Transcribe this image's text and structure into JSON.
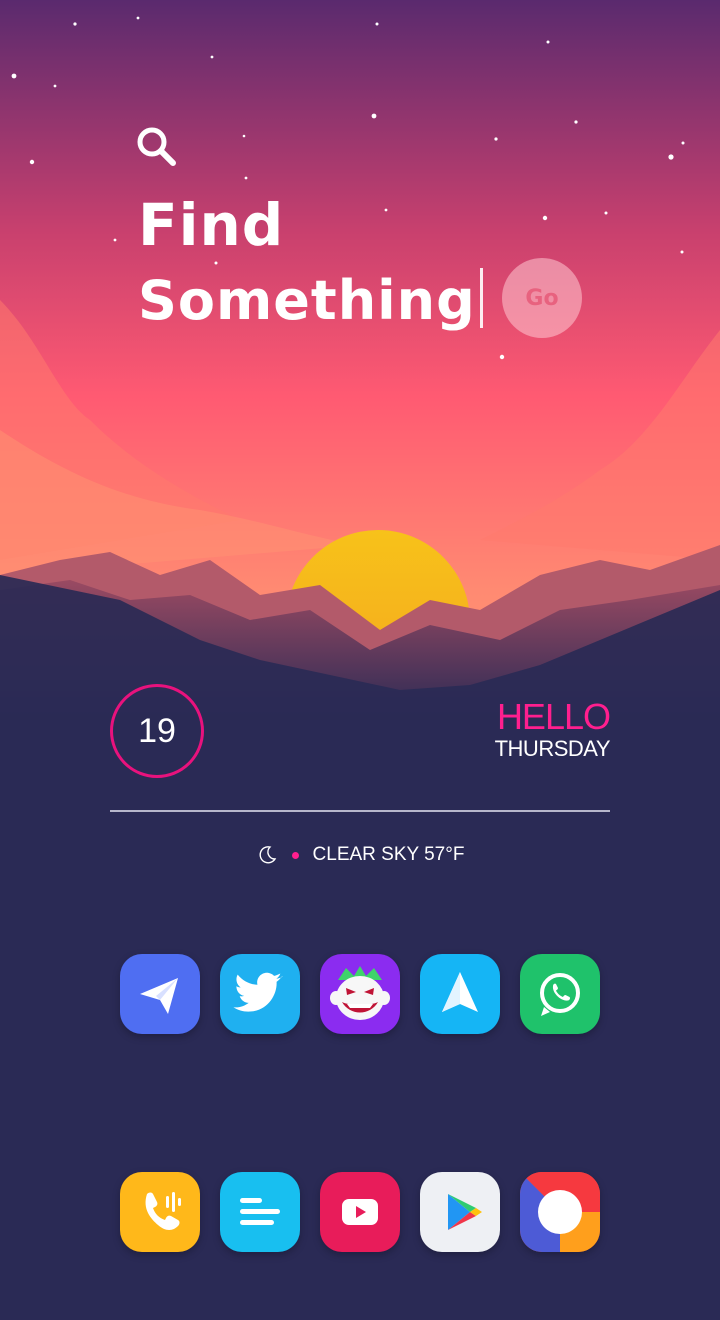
{
  "search": {
    "line1": "Find",
    "line2": "Something",
    "go_label": "Go"
  },
  "widget": {
    "date": "19",
    "greeting": "HELLO",
    "day": "THURSDAY",
    "weather": "CLEAR SKY 57°F"
  },
  "colors": {
    "accent": "#ff1f8e",
    "background": "#2a2a55",
    "sky_top": "#5a2a6e",
    "sky_bottom": "#ff7a6a",
    "sun": "#f7c21a"
  },
  "dock_rows": [
    {
      "apps": [
        {
          "name": "telegram",
          "icon": "paper-plane-icon",
          "color": "#4f6ef2"
        },
        {
          "name": "twitter",
          "icon": "bird-icon",
          "color": "#1fb0f0"
        },
        {
          "name": "joker-game",
          "icon": "joker-face-icon",
          "color": "#8b2cf0"
        },
        {
          "name": "spark-mail",
          "icon": "arrow-up-icon",
          "color": "#15b5f5"
        },
        {
          "name": "whatsapp",
          "icon": "whatsapp-icon",
          "color": "#1fc26b"
        }
      ]
    },
    {
      "apps": [
        {
          "name": "phone",
          "icon": "phone-icon",
          "color": "#ffb81a"
        },
        {
          "name": "messages",
          "icon": "lines-icon",
          "color": "#18bff0"
        },
        {
          "name": "youtube",
          "icon": "play-box-icon",
          "color": "#e81c5a"
        },
        {
          "name": "play-store",
          "icon": "play-triangle-icon",
          "color": "#eef0f4"
        },
        {
          "name": "chrome",
          "icon": "chrome-icon",
          "color": "#ff5a36"
        }
      ]
    }
  ]
}
